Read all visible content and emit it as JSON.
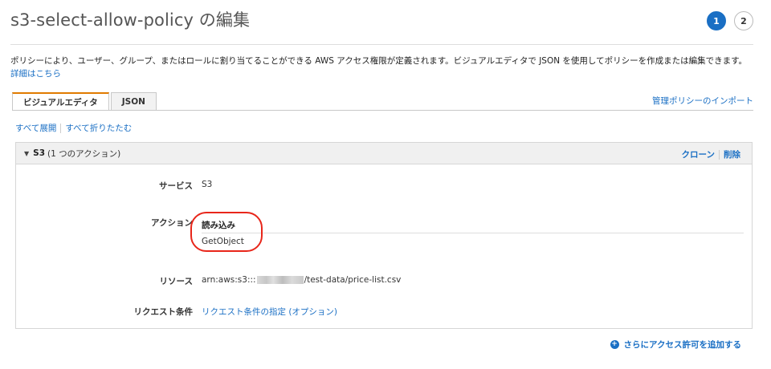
{
  "page": {
    "title": "s3-select-allow-policy の編集",
    "steps": [
      "1",
      "2"
    ],
    "description_text": "ポリシーにより、ユーザー、グループ、またはロールに割り当てることができる AWS アクセス権限が定義されます。ビジュアルエディタで JSON を使用してポリシーを作成または編集できます。",
    "description_link": "詳細はこちら"
  },
  "tabs": {
    "visual_editor": "ビジュアルエディタ",
    "json": "JSON",
    "import_link": "管理ポリシーのインポート"
  },
  "toolbar": {
    "expand_all": "すべて展開",
    "collapse_all": "すべて折りたたむ"
  },
  "service_panel": {
    "caret": "▼",
    "service_name": "S3",
    "action_count": "(1 つのアクション)",
    "clone": "クローン",
    "delete": "削除",
    "service_label": "サービス",
    "service_value": "S3",
    "actions_label": "アクション",
    "actions_group": "読み込み",
    "actions_item": "GetObject",
    "resources_label": "リソース",
    "resource_prefix": "arn:aws:s3:::",
    "resource_suffix": "/test-data/price-list.csv",
    "conditions_label": "リクエスト条件",
    "conditions_link": "リクエスト条件の指定 (オプション)"
  },
  "footer": {
    "add_permissions": "さらにアクセス許可を追加する"
  },
  "colors": {
    "link": "#1a6fc4",
    "tab_accent": "#e07b00",
    "annotation": "#e8261a"
  }
}
